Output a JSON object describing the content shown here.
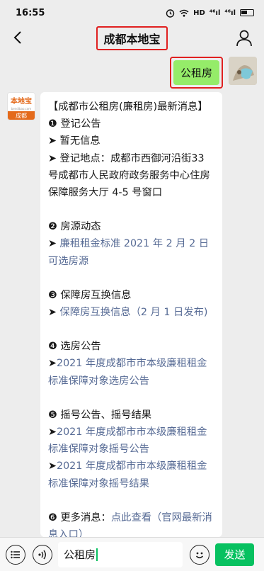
{
  "status": {
    "time": "16:55",
    "icons": [
      "alarm-icon",
      "wifi-icon",
      "hd-icon",
      "signal-icon",
      "signal-icon",
      "battery-icon"
    ],
    "hd": "HD",
    "sig1": "⁴⁶ıl",
    "sig2": "⁴⁶ıl"
  },
  "nav": {
    "title": "成都本地宝"
  },
  "outgoing": {
    "text": "公租房"
  },
  "incoming": {
    "avatar_top": "本地宝",
    "avatar_sub": "bendibao.com",
    "avatar_bottom": "成都",
    "heading": "【成都市公租房(廉租房)最新消息】",
    "s1_title": "❶ 登记公告",
    "s1_l1": "➤ 暂无信息",
    "s1_l2": "➤ 登记地点：成都市西御河沿街33 号成都市人民政府政务服务中心住房保障服务大厅 4-5 号窗口",
    "s2_title": "❷ 房源动态",
    "s2_arrow": "➤ ",
    "s2_link": "廉租租金标准 2021 年 2 月 2 日可选房源",
    "s3_title": "❸ 保障房互换信息",
    "s3_arrow": "➤ ",
    "s3_link": "保障房互换信息（2 月 1 日发布)",
    "s4_title": "❹ 选房公告",
    "s4_arrow": "➤",
    "s4_link": "2021 年度成都市市本级廉租租金标准保障对象选房公告",
    "s5_title": "❺ 摇号公告、摇号结果",
    "s5_arrow1": "➤",
    "s5_link1": "2021 年度成都市市本级廉租租金标准保障对象摇号公告",
    "s5_arrow2": "➤",
    "s5_link2": "2021 年度成都市市本级廉租租金标准保障对象摇号结果",
    "s6_title": "❻ 更多消息：",
    "s6_link": "点此查看（官网最新消息入口）"
  },
  "input": {
    "value": "公租房",
    "send_label": "发送"
  },
  "colors": {
    "accent": "#07c160",
    "bubble_out": "#95ec69",
    "link": "#576b95",
    "highlight": "#e02020"
  }
}
